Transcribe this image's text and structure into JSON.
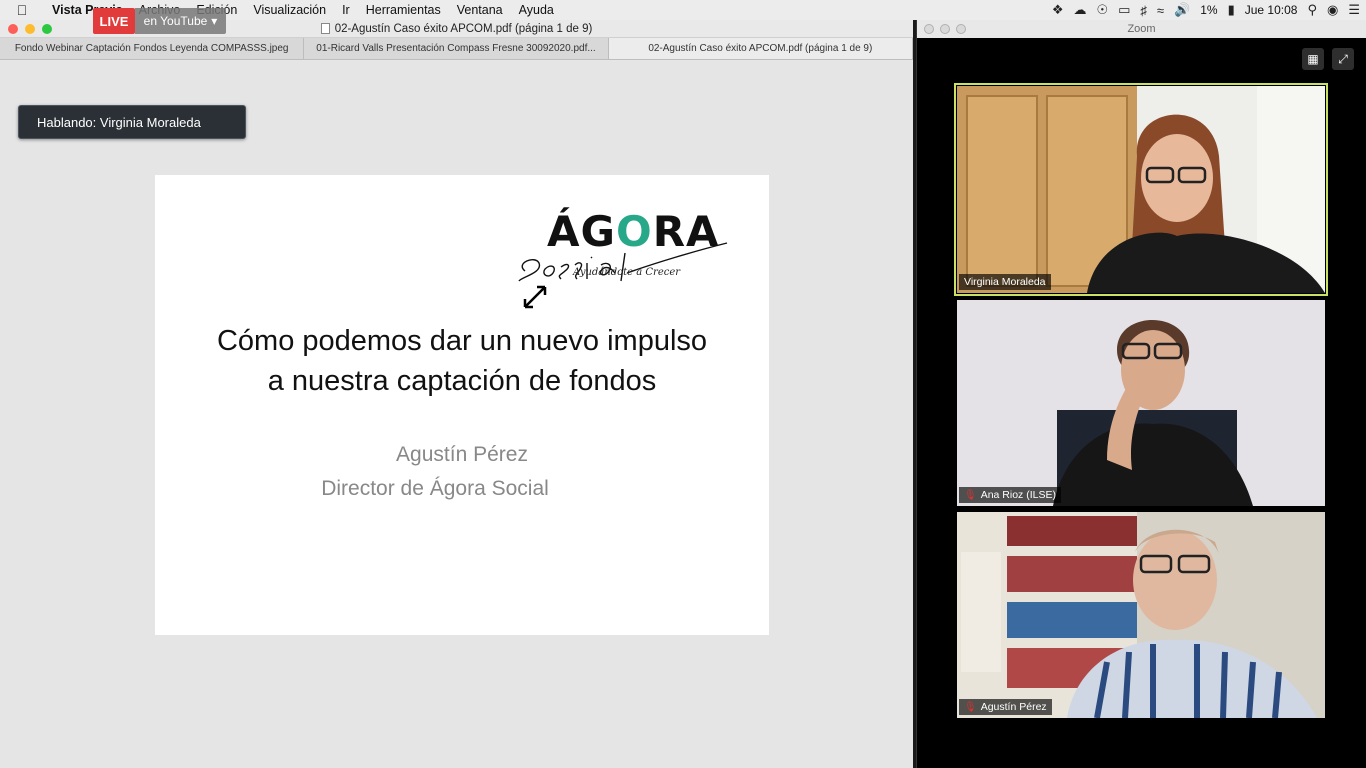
{
  "menubar": {
    "apple": "",
    "app_name": "Vista Previa",
    "items": [
      "Archivo",
      "Edición",
      "Visualización",
      "Ir",
      "Herramientas",
      "Ventana",
      "Ayuda"
    ],
    "battery": "1%",
    "clock": "Jue 10:08"
  },
  "live": {
    "badge": "LIVE",
    "destination": "en YouTube"
  },
  "preview": {
    "window_title": "02-Agustín Caso éxito APCOM.pdf (página 1 de 9)",
    "tabs": [
      {
        "label": "Fondo Webinar Captación Fondos Leyenda COMPASSS.jpeg"
      },
      {
        "label": "01-Ricard Valls Presentación Compass Fresne 30092020.pdf..."
      },
      {
        "label": "02-Agustín Caso éxito APCOM.pdf (página 1 de 9)"
      }
    ]
  },
  "speaking_banner": "Hablando: Virginia Moraleda",
  "slide": {
    "logo_word_pre": "ÁG",
    "logo_word_o": "O",
    "logo_word_post": "RA",
    "logo_tagline": "Ayudándote a Crecer",
    "title": "Cómo podemos dar un nuevo impulso a nuestra captación de fondos",
    "author": "Agustín Pérez",
    "role": "Director de Ágora Social"
  },
  "zoom": {
    "window_title": "Zoom",
    "participants": [
      {
        "name": "Virginia Moraleda",
        "muted": false,
        "active": true
      },
      {
        "name": "Ana Rioz (ILSE)",
        "muted": true,
        "active": false
      },
      {
        "name": "Agustín Pérez",
        "muted": true,
        "active": false
      }
    ]
  },
  "colors": {
    "live_red": "#e23b3b",
    "active_speaker_border": "#c9e265",
    "logo_accent": "#27a888"
  }
}
